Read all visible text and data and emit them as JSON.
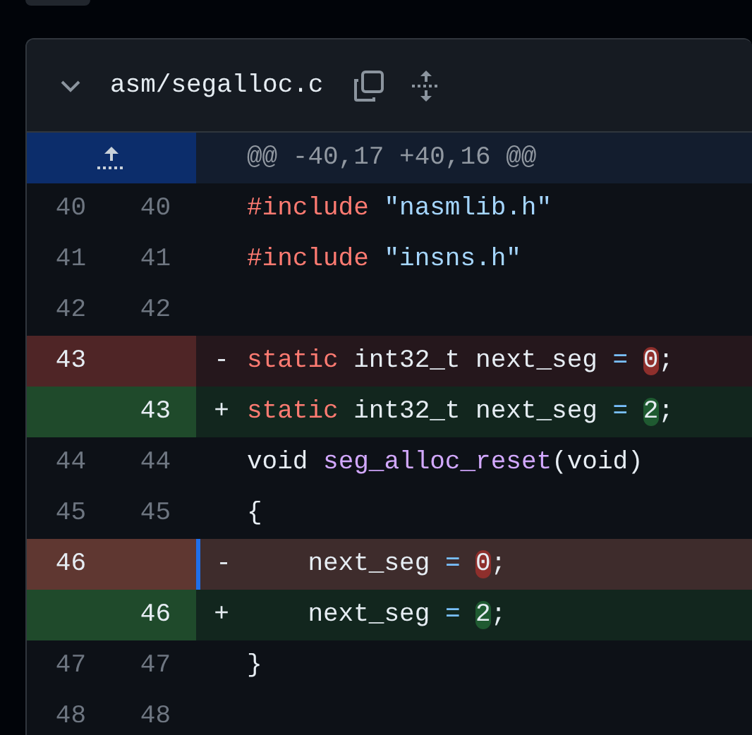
{
  "file": {
    "name": "asm/segalloc.c",
    "expanded": true
  },
  "hunk": {
    "header": "@@ -40,17 +40,16 @@"
  },
  "lines": [
    {
      "kind": "context",
      "old": "40",
      "new": "40",
      "selected": false,
      "tokens": [
        {
          "kind": "keyword",
          "text": "#include "
        },
        {
          "kind": "string",
          "text": "\"nasmlib.h\""
        }
      ]
    },
    {
      "kind": "context",
      "old": "41",
      "new": "41",
      "selected": false,
      "tokens": [
        {
          "kind": "keyword",
          "text": "#include "
        },
        {
          "kind": "string",
          "text": "\"insns.h\""
        }
      ]
    },
    {
      "kind": "context",
      "old": "42",
      "new": "42",
      "selected": false
    },
    {
      "kind": "deletion",
      "old": "43",
      "marker": "-",
      "selected": false,
      "tokens": [
        {
          "kind": "keyword",
          "text": "static"
        },
        {
          "kind": "plain",
          "text": " int32_t next_seg "
        },
        {
          "kind": "operator",
          "text": "= "
        },
        {
          "kind": "changed",
          "text": "0"
        },
        {
          "kind": "plain",
          "text": ";"
        }
      ]
    },
    {
      "kind": "addition",
      "new": "43",
      "marker": "+",
      "selected": false,
      "tokens": [
        {
          "kind": "keyword",
          "text": "static"
        },
        {
          "kind": "plain",
          "text": " int32_t next_seg "
        },
        {
          "kind": "operator",
          "text": "= "
        },
        {
          "kind": "changed",
          "text": "2"
        },
        {
          "kind": "plain",
          "text": ";"
        }
      ]
    },
    {
      "kind": "context",
      "old": "44",
      "new": "44",
      "selected": false,
      "tokens": [
        {
          "kind": "plain",
          "text": "void "
        },
        {
          "kind": "function",
          "text": "seg_alloc_reset"
        },
        {
          "kind": "plain",
          "text": "(void)"
        }
      ]
    },
    {
      "kind": "context",
      "old": "45",
      "new": "45",
      "selected": false,
      "tokens": [
        {
          "kind": "plain",
          "text": "{"
        }
      ]
    },
    {
      "kind": "deletion",
      "old": "46",
      "marker": "-",
      "selected": true,
      "tokens": [
        {
          "kind": "plain",
          "text": "    next_seg "
        },
        {
          "kind": "operator",
          "text": "= "
        },
        {
          "kind": "changed",
          "text": "0"
        },
        {
          "kind": "plain",
          "text": ";"
        }
      ]
    },
    {
      "kind": "addition",
      "new": "46",
      "marker": "+",
      "selected": false,
      "tokens": [
        {
          "kind": "plain",
          "text": "    next_seg "
        },
        {
          "kind": "operator",
          "text": "= "
        },
        {
          "kind": "changed",
          "text": "2"
        },
        {
          "kind": "plain",
          "text": ";"
        }
      ]
    },
    {
      "kind": "context",
      "old": "47",
      "new": "47",
      "selected": false,
      "tokens": [
        {
          "kind": "plain",
          "text": "}"
        }
      ]
    },
    {
      "kind": "context",
      "old": "48",
      "new": "48",
      "selected": false
    }
  ]
}
